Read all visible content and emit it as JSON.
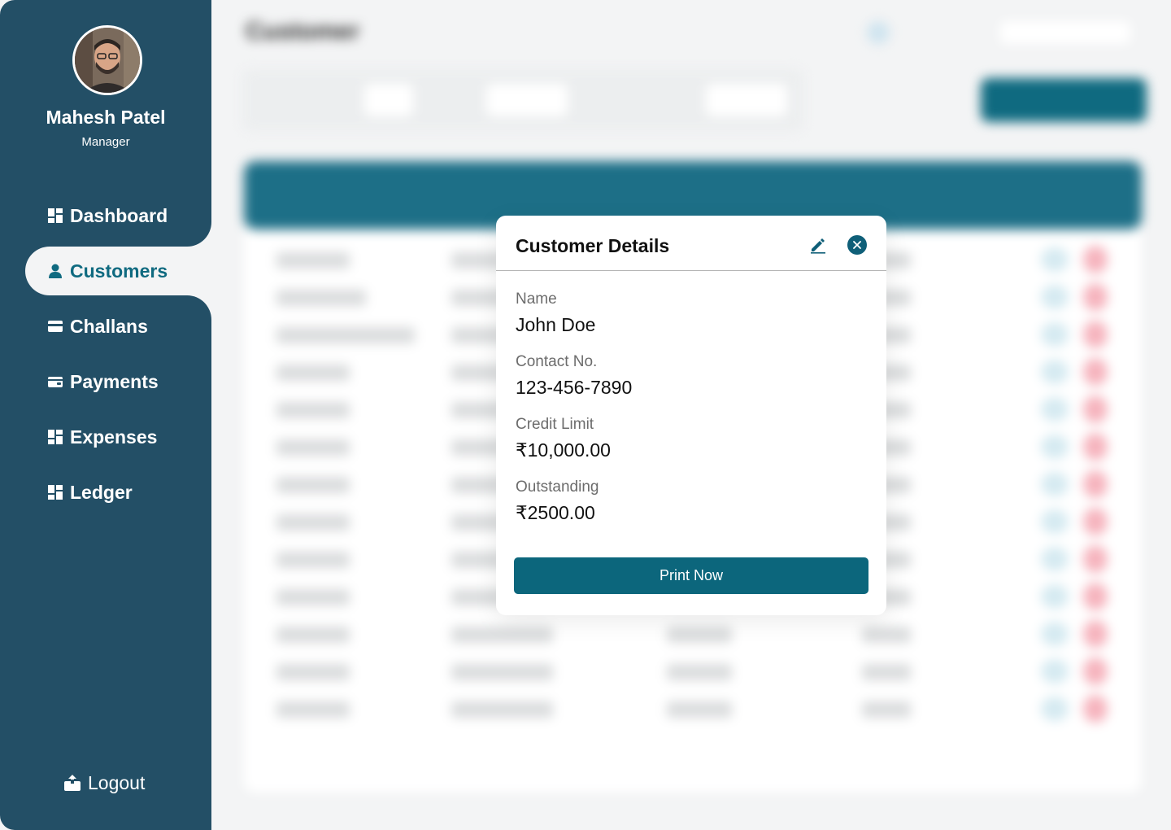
{
  "user": {
    "name": "Mahesh Patel",
    "role": "Manager"
  },
  "nav": {
    "items": [
      {
        "label": "Dashboard",
        "icon": "dashboard-icon"
      },
      {
        "label": "Customers",
        "icon": "user-icon",
        "active": true
      },
      {
        "label": "Challans",
        "icon": "card-icon"
      },
      {
        "label": "Payments",
        "icon": "wallet-icon"
      },
      {
        "label": "Expenses",
        "icon": "dashboard-icon"
      },
      {
        "label": "Ledger",
        "icon": "dashboard-icon"
      }
    ],
    "logout_label": "Logout"
  },
  "modal": {
    "title": "Customer Details",
    "fields": [
      {
        "label": "Name",
        "value": "John Doe"
      },
      {
        "label": "Contact No.",
        "value": "123-456-7890"
      },
      {
        "label": "Credit Limit",
        "value": "₹10,000.00"
      },
      {
        "label": "Outstanding",
        "value": "₹2500.00"
      }
    ],
    "print_label": "Print Now"
  },
  "colors": {
    "sidebar": "#234f66",
    "accent": "#0f6a80",
    "page_bg": "#f3f4f5",
    "close_button": "#0f5f78",
    "delete_dot": "#f6b3bd"
  }
}
